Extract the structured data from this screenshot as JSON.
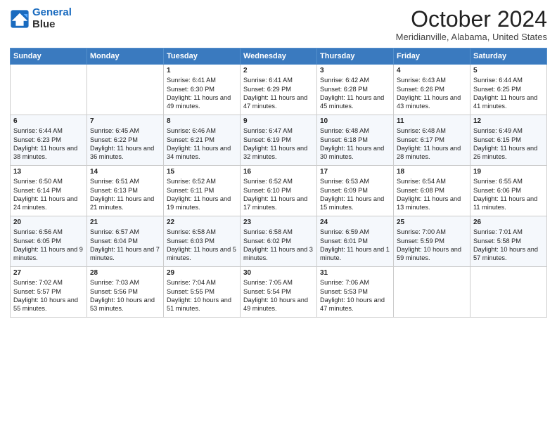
{
  "header": {
    "logo_line1": "General",
    "logo_line2": "Blue",
    "title": "October 2024",
    "subtitle": "Meridianville, Alabama, United States"
  },
  "days_of_week": [
    "Sunday",
    "Monday",
    "Tuesday",
    "Wednesday",
    "Thursday",
    "Friday",
    "Saturday"
  ],
  "weeks": [
    [
      {
        "day": "",
        "content": ""
      },
      {
        "day": "",
        "content": ""
      },
      {
        "day": "1",
        "content": "Sunrise: 6:41 AM\nSunset: 6:30 PM\nDaylight: 11 hours and 49 minutes."
      },
      {
        "day": "2",
        "content": "Sunrise: 6:41 AM\nSunset: 6:29 PM\nDaylight: 11 hours and 47 minutes."
      },
      {
        "day": "3",
        "content": "Sunrise: 6:42 AM\nSunset: 6:28 PM\nDaylight: 11 hours and 45 minutes."
      },
      {
        "day": "4",
        "content": "Sunrise: 6:43 AM\nSunset: 6:26 PM\nDaylight: 11 hours and 43 minutes."
      },
      {
        "day": "5",
        "content": "Sunrise: 6:44 AM\nSunset: 6:25 PM\nDaylight: 11 hours and 41 minutes."
      }
    ],
    [
      {
        "day": "6",
        "content": "Sunrise: 6:44 AM\nSunset: 6:23 PM\nDaylight: 11 hours and 38 minutes."
      },
      {
        "day": "7",
        "content": "Sunrise: 6:45 AM\nSunset: 6:22 PM\nDaylight: 11 hours and 36 minutes."
      },
      {
        "day": "8",
        "content": "Sunrise: 6:46 AM\nSunset: 6:21 PM\nDaylight: 11 hours and 34 minutes."
      },
      {
        "day": "9",
        "content": "Sunrise: 6:47 AM\nSunset: 6:19 PM\nDaylight: 11 hours and 32 minutes."
      },
      {
        "day": "10",
        "content": "Sunrise: 6:48 AM\nSunset: 6:18 PM\nDaylight: 11 hours and 30 minutes."
      },
      {
        "day": "11",
        "content": "Sunrise: 6:48 AM\nSunset: 6:17 PM\nDaylight: 11 hours and 28 minutes."
      },
      {
        "day": "12",
        "content": "Sunrise: 6:49 AM\nSunset: 6:15 PM\nDaylight: 11 hours and 26 minutes."
      }
    ],
    [
      {
        "day": "13",
        "content": "Sunrise: 6:50 AM\nSunset: 6:14 PM\nDaylight: 11 hours and 24 minutes."
      },
      {
        "day": "14",
        "content": "Sunrise: 6:51 AM\nSunset: 6:13 PM\nDaylight: 11 hours and 21 minutes."
      },
      {
        "day": "15",
        "content": "Sunrise: 6:52 AM\nSunset: 6:11 PM\nDaylight: 11 hours and 19 minutes."
      },
      {
        "day": "16",
        "content": "Sunrise: 6:52 AM\nSunset: 6:10 PM\nDaylight: 11 hours and 17 minutes."
      },
      {
        "day": "17",
        "content": "Sunrise: 6:53 AM\nSunset: 6:09 PM\nDaylight: 11 hours and 15 minutes."
      },
      {
        "day": "18",
        "content": "Sunrise: 6:54 AM\nSunset: 6:08 PM\nDaylight: 11 hours and 13 minutes."
      },
      {
        "day": "19",
        "content": "Sunrise: 6:55 AM\nSunset: 6:06 PM\nDaylight: 11 hours and 11 minutes."
      }
    ],
    [
      {
        "day": "20",
        "content": "Sunrise: 6:56 AM\nSunset: 6:05 PM\nDaylight: 11 hours and 9 minutes."
      },
      {
        "day": "21",
        "content": "Sunrise: 6:57 AM\nSunset: 6:04 PM\nDaylight: 11 hours and 7 minutes."
      },
      {
        "day": "22",
        "content": "Sunrise: 6:58 AM\nSunset: 6:03 PM\nDaylight: 11 hours and 5 minutes."
      },
      {
        "day": "23",
        "content": "Sunrise: 6:58 AM\nSunset: 6:02 PM\nDaylight: 11 hours and 3 minutes."
      },
      {
        "day": "24",
        "content": "Sunrise: 6:59 AM\nSunset: 6:01 PM\nDaylight: 11 hours and 1 minute."
      },
      {
        "day": "25",
        "content": "Sunrise: 7:00 AM\nSunset: 5:59 PM\nDaylight: 10 hours and 59 minutes."
      },
      {
        "day": "26",
        "content": "Sunrise: 7:01 AM\nSunset: 5:58 PM\nDaylight: 10 hours and 57 minutes."
      }
    ],
    [
      {
        "day": "27",
        "content": "Sunrise: 7:02 AM\nSunset: 5:57 PM\nDaylight: 10 hours and 55 minutes."
      },
      {
        "day": "28",
        "content": "Sunrise: 7:03 AM\nSunset: 5:56 PM\nDaylight: 10 hours and 53 minutes."
      },
      {
        "day": "29",
        "content": "Sunrise: 7:04 AM\nSunset: 5:55 PM\nDaylight: 10 hours and 51 minutes."
      },
      {
        "day": "30",
        "content": "Sunrise: 7:05 AM\nSunset: 5:54 PM\nDaylight: 10 hours and 49 minutes."
      },
      {
        "day": "31",
        "content": "Sunrise: 7:06 AM\nSunset: 5:53 PM\nDaylight: 10 hours and 47 minutes."
      },
      {
        "day": "",
        "content": ""
      },
      {
        "day": "",
        "content": ""
      }
    ]
  ]
}
